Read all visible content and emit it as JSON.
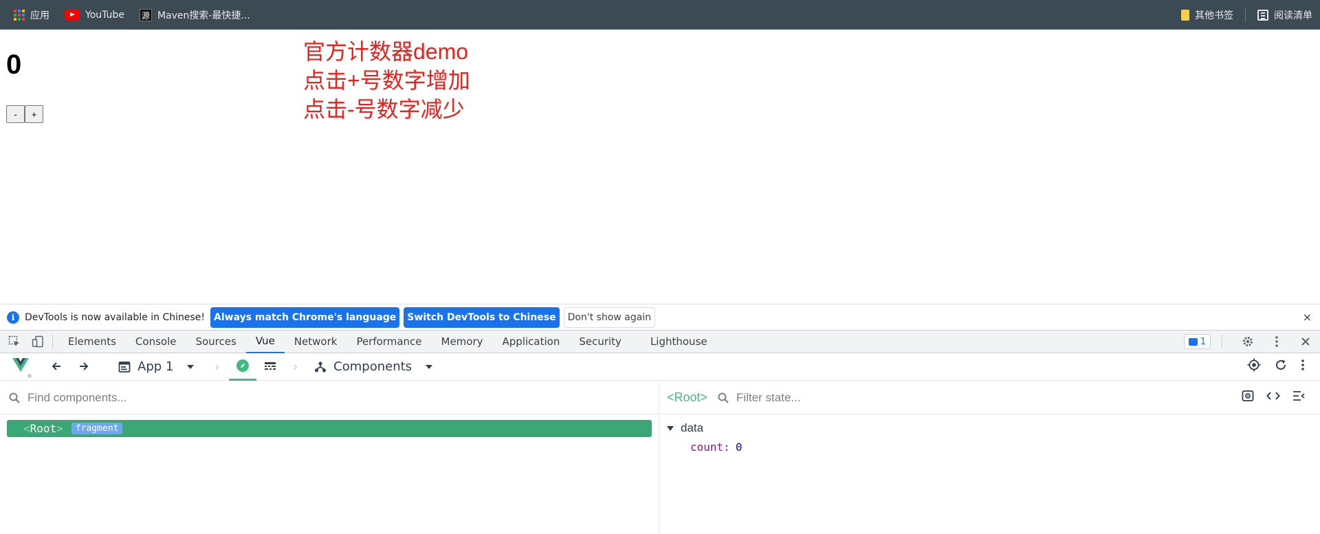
{
  "bookmarks": {
    "items": [
      {
        "label": "应用"
      },
      {
        "label": "YouTube"
      },
      {
        "label": "Maven搜索-最快捷..."
      }
    ],
    "src_glyph": "源",
    "other_label": "其他书签",
    "reading_label": "阅读清单"
  },
  "page": {
    "count": "0",
    "minus_label": "-",
    "plus_label": "+",
    "notes": [
      "官方计数器demo",
      "点击+号数字增加",
      "点击-号数字减少"
    ],
    "notes_color": "#e6231e"
  },
  "infobar": {
    "icon": "i",
    "message": "DevTools is now available in Chinese!",
    "btn_match": "Always match Chrome's language",
    "btn_switch": "Switch DevTools to Chinese",
    "btn_dont_show": "Don't show again",
    "close": "×"
  },
  "devtools": {
    "tabs": [
      "Elements",
      "Console",
      "Sources",
      "Vue",
      "Network",
      "Performance",
      "Memory",
      "Application",
      "Security",
      "Lighthouse"
    ],
    "active_tab": "Vue",
    "issues_count": "1",
    "accent": "#1a73e8"
  },
  "vue": {
    "app_label": "App 1",
    "view_label": "Components",
    "accent": "#42b883",
    "find_placeholder": "Find components...",
    "filter_placeholder": "Filter state...",
    "root_open": "<",
    "root_name": "Root",
    "root_close": ">",
    "root_badge": "fragment",
    "right_root_label": "<Root>",
    "state_section": "data",
    "state_key": "count",
    "state_colon": ":",
    "state_value": "0"
  }
}
